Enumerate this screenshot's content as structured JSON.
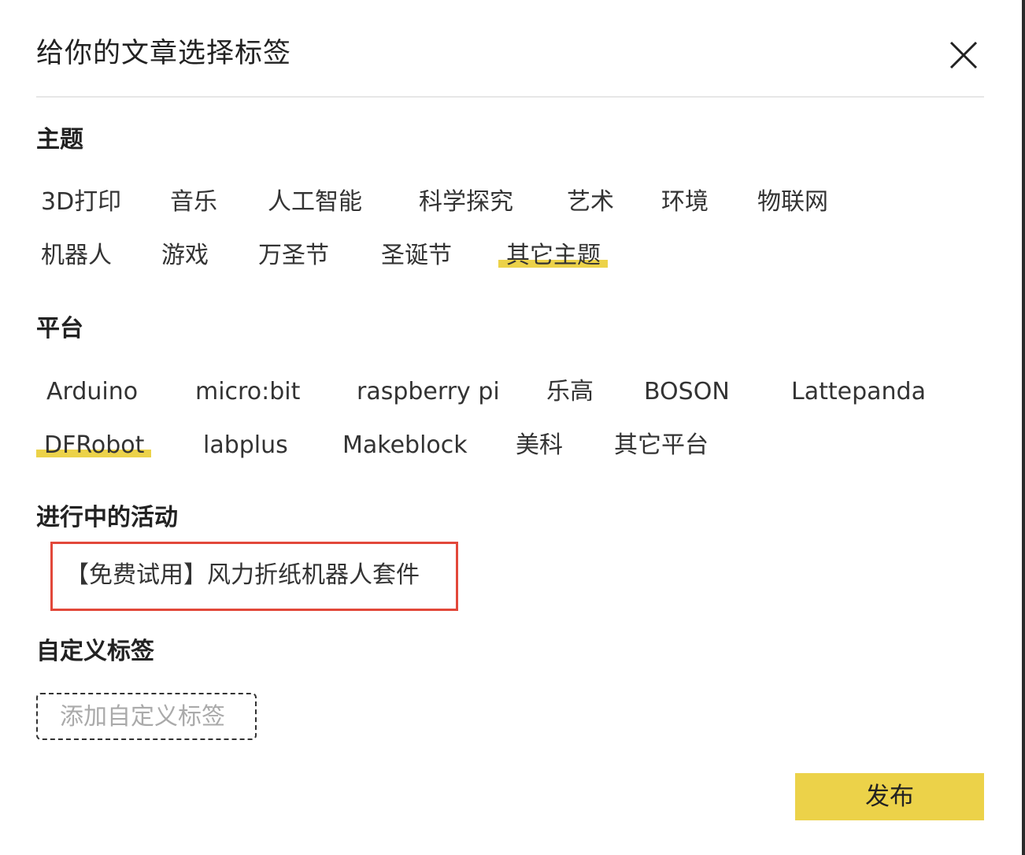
{
  "dialog": {
    "title": "给你的文章选择标签",
    "close_icon": "close-icon"
  },
  "colors": {
    "highlight": "#ecd249",
    "activity_border": "#e2483a",
    "publish_button": "#ecd249"
  },
  "sections": {
    "theme": {
      "title": "主题",
      "tags": [
        "3D打印",
        "音乐",
        "人工智能",
        "科学探究",
        "艺术",
        "环境",
        "物联网",
        "机器人",
        "游戏",
        "万圣节",
        "圣诞节",
        "其它主题"
      ],
      "selected": "其它主题"
    },
    "platform": {
      "title": "平台",
      "tags": [
        "Arduino",
        "micro:bit",
        "raspberry pi",
        "乐高",
        "BOSON",
        "Lattepanda",
        "DFRobot",
        "labplus",
        "Makeblock",
        "美科",
        "其它平台"
      ],
      "selected": "DFRobot"
    },
    "activity": {
      "title": "进行中的活动",
      "items": [
        "【免费试用】风力折纸机器人套件"
      ]
    },
    "custom": {
      "title": "自定义标签",
      "placeholder": "添加自定义标签"
    }
  },
  "publish": {
    "label": "发布"
  }
}
